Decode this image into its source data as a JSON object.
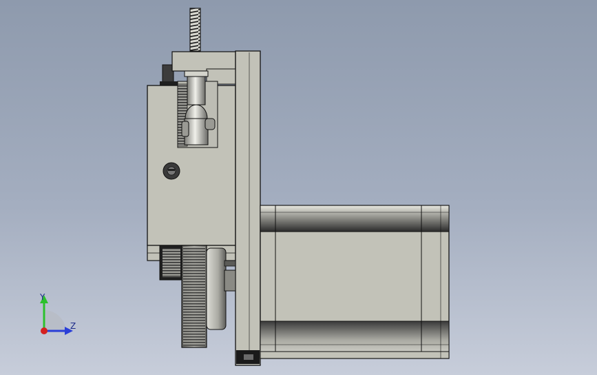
{
  "viewport": {
    "background_top": "#8e9aad",
    "background_bottom": "#c7cdda"
  },
  "model": {
    "body_color": "#c2c2b8",
    "edge_color": "#1a1a1a",
    "gear_color": "#8a8a85",
    "dark_color": "#2a2a2a",
    "parts": [
      "lead-screw",
      "mounting-plate",
      "carriage-block",
      "set-screw",
      "gear",
      "stepper-motor"
    ]
  },
  "triad": {
    "x_label": "",
    "y_label": "Y",
    "z_label": "Z",
    "y_color": "#2cc12c",
    "z_color": "#2a3fd8",
    "origin_color": "#d42020"
  }
}
